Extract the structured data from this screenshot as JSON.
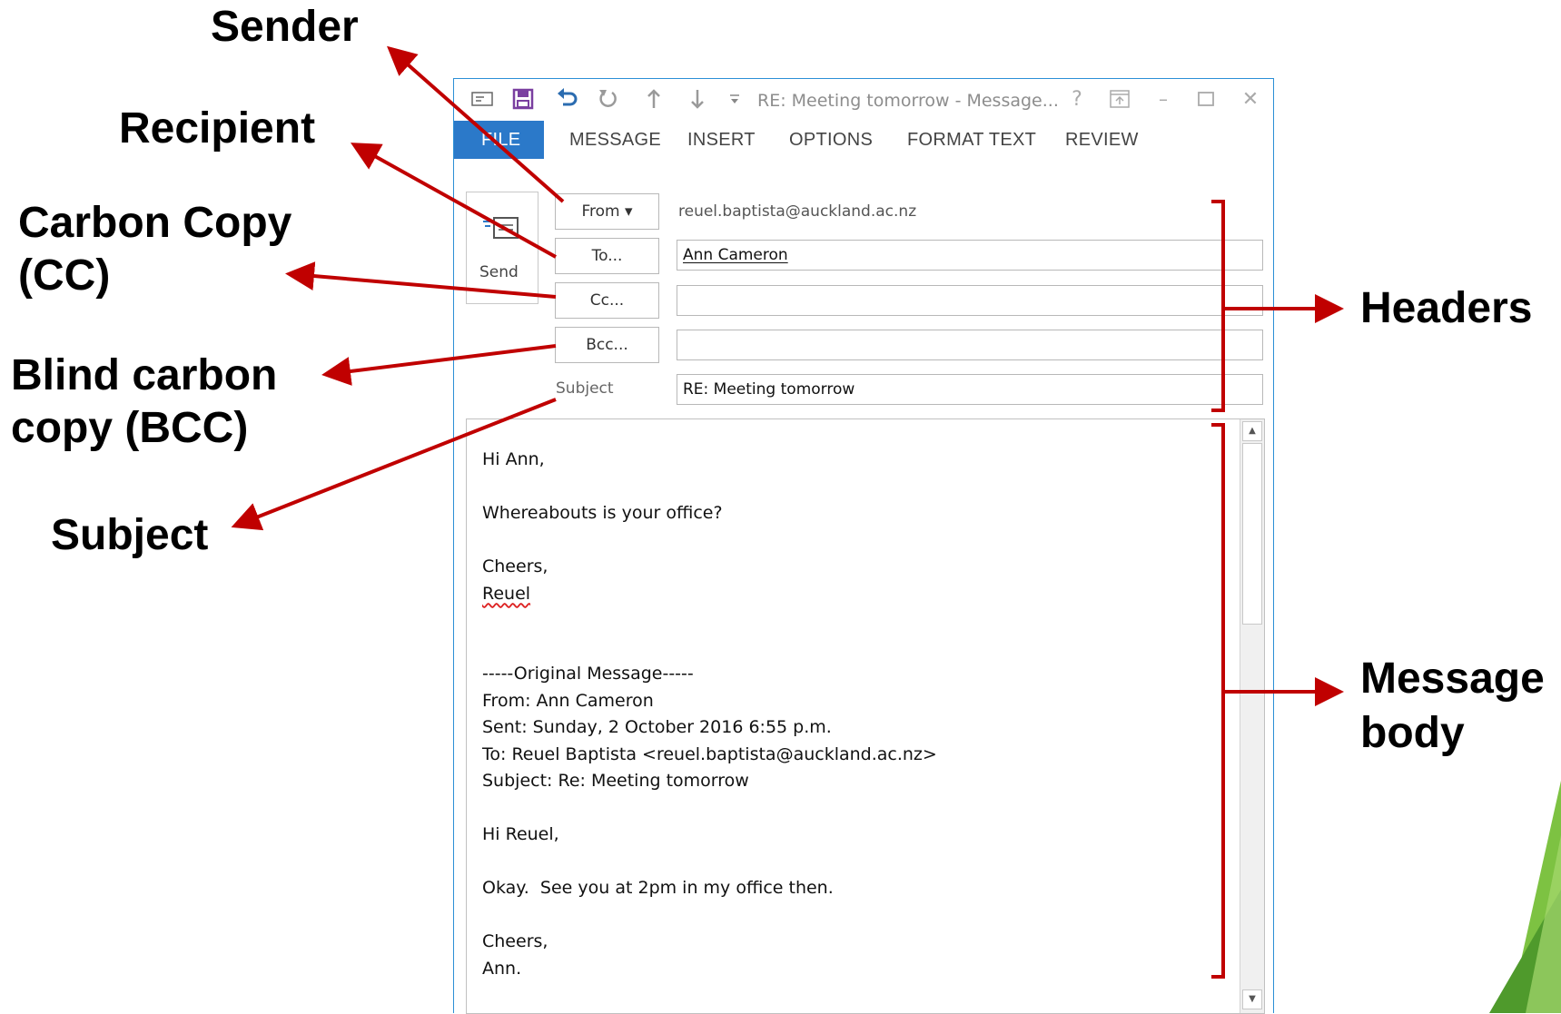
{
  "annotations": {
    "sender": "Sender",
    "recipient": "Recipient",
    "cc_line1": "Carbon Copy",
    "cc_line2": "(CC)",
    "bcc_line1": "Blind carbon",
    "bcc_line2": "copy (BCC)",
    "subject": "Subject",
    "headers": "Headers",
    "body_line1": "Message",
    "body_line2": "body"
  },
  "colors": {
    "arrow": "#c00000",
    "accent": "#2b79c9",
    "slide_green": "#7dc242"
  },
  "window": {
    "title": "RE: Meeting tomorrow - Message...",
    "tabs": [
      "FILE",
      "MESSAGE",
      "INSERT",
      "OPTIONS",
      "FORMAT TEXT",
      "REVIEW"
    ],
    "controls": {
      "help": "?",
      "minimize": "–",
      "close": "✕"
    }
  },
  "header": {
    "send_label": "Send",
    "from_label": "From ▾",
    "from_value": "reuel.baptista@auckland.ac.nz",
    "to_label": "To...",
    "to_value": "Ann Cameron",
    "cc_label": "Cc...",
    "cc_value": "",
    "bcc_label": "Bcc...",
    "bcc_value": "",
    "subject_label": "Subject",
    "subject_value": "RE: Meeting tomorrow"
  },
  "body": {
    "lines": [
      "Hi Ann,",
      "",
      "Whereabouts is your office?",
      "",
      "Cheers,",
      "Reuel",
      "",
      "",
      "-----Original Message-----",
      "From: Ann Cameron",
      "Sent: Sunday, 2 October 2016 6:55 p.m.",
      "To: Reuel Baptista <reuel.baptista@auckland.ac.nz>",
      "Subject: Re: Meeting tomorrow",
      "",
      "Hi Reuel,",
      "",
      "Okay.  See you at 2pm in my office then.",
      "",
      "Cheers,",
      "Ann."
    ]
  }
}
